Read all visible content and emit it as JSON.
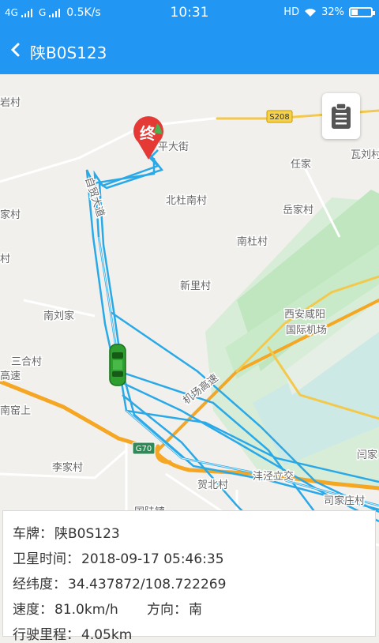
{
  "status_bar": {
    "network_1": "4G",
    "network_2": "G",
    "speed": "0.5K/s",
    "time": "10:31",
    "hd": "HD",
    "battery_percent": "32%",
    "battery_level": 0.32
  },
  "header": {
    "title": "陕B0S123"
  },
  "map": {
    "end_marker_label": "终",
    "road_shield_s208": "S208",
    "road_shield_g70": "G70",
    "labels": [
      "岩村",
      "平大街",
      "任家",
      "瓦刘村",
      "自贸大道",
      "北杜南村",
      "岳家村",
      "家村",
      "南杜村",
      "村",
      "新里村",
      "西安咸阳",
      "国际机场",
      "南刘家",
      "三合村",
      "高速",
      "机场高速",
      "南窑上",
      "李家村",
      "贺北村",
      "沣泾立交",
      "闫家",
      "司家庄村",
      "国陆镇"
    ]
  },
  "info": {
    "plate_label": "车牌：",
    "plate_value": "陕B0S123",
    "sat_time_label": "卫星时间：",
    "sat_time_value": "2018-09-17 05:46:35",
    "coords_label": "经纬度：",
    "coords_value": "34.437872/108.722269",
    "speed_label": "速度：",
    "speed_value": "81.0km/h",
    "direction_label": "方向：",
    "direction_value": "南",
    "mileage_label": "行驶里程：",
    "mileage_value": "4.05km"
  }
}
